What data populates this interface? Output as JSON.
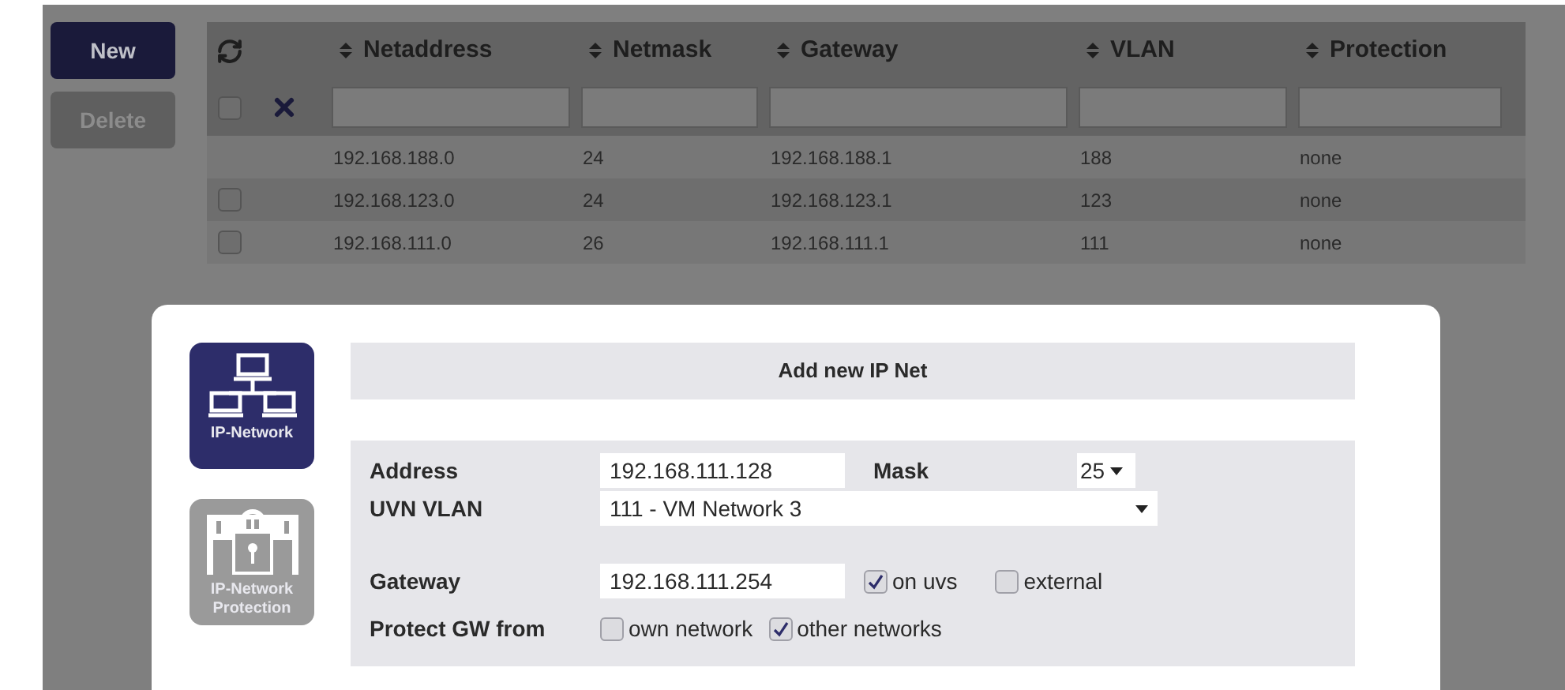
{
  "buttons": [
    {
      "label": "New",
      "disabled": false
    },
    {
      "label": "Delete",
      "disabled": true
    }
  ],
  "table": {
    "columns": [
      "Netaddress",
      "Netmask",
      "Gateway",
      "VLAN",
      "Protection"
    ],
    "select_all": {
      "checked": false
    },
    "rows": [
      {
        "kind": "plain",
        "cells": [
          "192.168.188.0",
          "24",
          "192.168.188.1",
          "188",
          "none"
        ]
      },
      {
        "kind": "checkbox",
        "checked": false,
        "cells": [
          "192.168.123.0",
          "24",
          "192.168.123.1",
          "123",
          "none"
        ]
      },
      {
        "kind": "checkbox",
        "checked": false,
        "cells": [
          "192.168.111.0",
          "26",
          "192.168.111.1",
          "111",
          "none"
        ]
      }
    ]
  },
  "dialog": {
    "tiles": [
      {
        "kind": "network",
        "label": "IP-Network",
        "selected": true
      },
      {
        "kind": "protection",
        "label": "IP-Network Protection",
        "selected": false
      }
    ],
    "title": "Add new IP Net",
    "address": {
      "label": "Address",
      "value": "192.168.111.128"
    },
    "mask": {
      "label": "Mask",
      "value": "25"
    },
    "vlan": {
      "label": "UVN VLAN",
      "value": "111 - VM Network 3"
    },
    "gateway": {
      "label": "Gateway",
      "value": "192.168.111.254",
      "options": [
        {
          "label": "on uvs",
          "checked": true
        },
        {
          "label": "external",
          "checked": false
        }
      ]
    },
    "protect": {
      "label": "Protect GW from",
      "options": [
        {
          "label": "own network",
          "checked": false
        },
        {
          "label": "other networks",
          "checked": true
        }
      ]
    }
  }
}
